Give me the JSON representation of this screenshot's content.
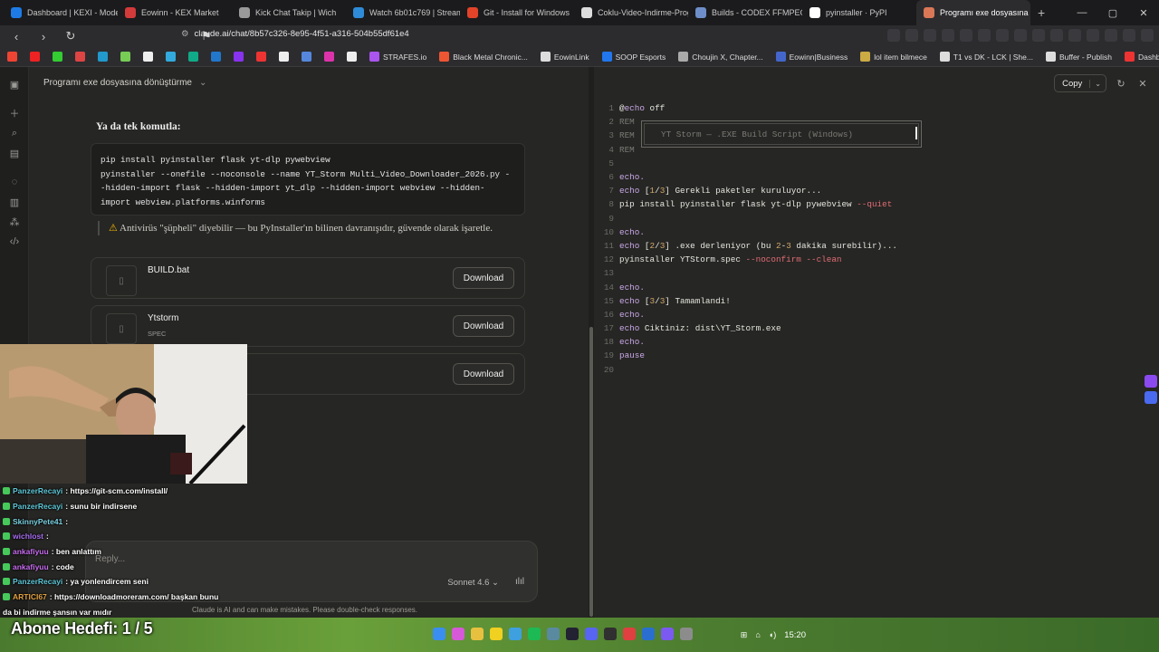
{
  "browser": {
    "tabs": [
      {
        "label": "Dashboard | KEXI - Modern",
        "color": "#1e7be6"
      },
      {
        "label": "Eowinn - KEX Market",
        "color": "#d33a3a"
      },
      {
        "label": "Kick Chat Takip | Wich",
        "color": "#9a9a9a"
      },
      {
        "label": "Watch 6b01c769 | Streamable",
        "color": "#2e8bd8"
      },
      {
        "label": "Git - Install for Windows",
        "color": "#e24329"
      },
      {
        "label": "Coklu-Video-Indirme-Program",
        "color": "#dddddd"
      },
      {
        "label": "Builds - CODEX FFMPEG @",
        "color": "#6e8ec9"
      },
      {
        "label": "pyinstaller · PyPI",
        "color": "#ffffff"
      },
      {
        "label": "Programı exe dosyasına",
        "color": "#d97757"
      }
    ],
    "url": "claude.ai/chat/8b57c326-8e95-4f51-a316-504b55df61e4",
    "bookmarks": [
      {
        "label": "",
        "color": "#e43"
      },
      {
        "label": "",
        "color": "#e22"
      },
      {
        "label": "",
        "color": "#3c3"
      },
      {
        "label": "",
        "color": "#d44"
      },
      {
        "label": "",
        "color": "#29c"
      },
      {
        "label": "",
        "color": "#7c5"
      },
      {
        "label": "",
        "color": "#eee"
      },
      {
        "label": "",
        "color": "#3ad"
      },
      {
        "label": "",
        "color": "#1a8"
      },
      {
        "label": "",
        "color": "#27c"
      },
      {
        "label": "",
        "color": "#83e"
      },
      {
        "label": "",
        "color": "#e33"
      },
      {
        "label": "",
        "color": "#eee"
      },
      {
        "label": "",
        "color": "#58d"
      },
      {
        "label": "",
        "color": "#d3a"
      },
      {
        "label": "",
        "color": "#eee"
      },
      {
        "label": "STRAFES.io",
        "color": "#a5e"
      },
      {
        "label": "Black Metal Chronic...",
        "color": "#e53"
      },
      {
        "label": "EowinLink",
        "color": "#ddd"
      },
      {
        "label": "SOOP Esports",
        "color": "#27e"
      },
      {
        "label": "Choujin X, Chapter...",
        "color": "#aaa"
      },
      {
        "label": "Eowinn|Business",
        "color": "#46c"
      },
      {
        "label": "lol item bilmece",
        "color": "#ca4"
      },
      {
        "label": "T1 vs DK - LCK | She...",
        "color": "#ddd"
      },
      {
        "label": "Buffer - Publish",
        "color": "#ddd"
      },
      {
        "label": "Dashboard | KEXI -...",
        "color": "#e33"
      }
    ]
  },
  "chat": {
    "title": "Programı exe dosyasına dönüştürme",
    "heading": "Ya da tek komutla:",
    "code": "pip install pyinstaller flask yt-dlp pywebview\npyinstaller --onefile --noconsole --name YT_Storm Multi_Video_Downloader_2026.py -\n-hidden-import flask --hidden-import yt_dlp --hidden-import webview --hidden-\nimport webview.platforms.winforms",
    "warning": "Antivirüs \"şüpheli\" diyebilir — bu PyInstaller'ın bilinen davranışıdır, güvende olarak işaretle.",
    "files": [
      {
        "name": "BUILD.bat",
        "sub": "",
        "button": "Download"
      },
      {
        "name": "Ytstorm",
        "sub": "SPEC",
        "button": "Download"
      },
      {
        "name": "",
        "sub": "",
        "button": "Download"
      }
    ],
    "input_placeholder": "Reply...",
    "model": "Sonnet 4.6",
    "disclaimer": "Claude is AI and can make mistakes. Please double-check responses."
  },
  "artifact": {
    "copy_label": "Copy",
    "banner_text": "YT Storm — .EXE Build Script (Windows)",
    "lines": [
      {
        "n": "1",
        "parts": [
          {
            "t": "@",
            "c": "tx"
          },
          {
            "t": "echo",
            "c": "kw"
          },
          {
            "t": " off",
            "c": "tx"
          }
        ]
      },
      {
        "n": "2",
        "parts": [
          {
            "t": "REM",
            "c": "cm"
          }
        ]
      },
      {
        "n": "3",
        "parts": [
          {
            "t": "REM",
            "c": "cm"
          }
        ]
      },
      {
        "n": "4",
        "parts": [
          {
            "t": "REM",
            "c": "cm"
          }
        ]
      },
      {
        "n": "5",
        "parts": []
      },
      {
        "n": "6",
        "parts": [
          {
            "t": "echo.",
            "c": "kw"
          }
        ]
      },
      {
        "n": "7",
        "parts": [
          {
            "t": "echo",
            "c": "kw"
          },
          {
            "t": " [",
            "c": "tx"
          },
          {
            "t": "1",
            "c": "nb"
          },
          {
            "t": "/",
            "c": "tx"
          },
          {
            "t": "3",
            "c": "nb"
          },
          {
            "t": "] Gerekli paketler kuruluyor...",
            "c": "tx"
          }
        ]
      },
      {
        "n": "8",
        "parts": [
          {
            "t": "pip install pyinstaller flask yt-dlp pywebview ",
            "c": "tx"
          },
          {
            "t": "--quiet",
            "c": "fl"
          }
        ]
      },
      {
        "n": "9",
        "parts": []
      },
      {
        "n": "10",
        "parts": [
          {
            "t": "echo.",
            "c": "kw"
          }
        ]
      },
      {
        "n": "11",
        "parts": [
          {
            "t": "echo",
            "c": "kw"
          },
          {
            "t": " [",
            "c": "tx"
          },
          {
            "t": "2",
            "c": "nb"
          },
          {
            "t": "/",
            "c": "tx"
          },
          {
            "t": "3",
            "c": "nb"
          },
          {
            "t": "] .exe derleniyor (bu ",
            "c": "tx"
          },
          {
            "t": "2",
            "c": "nb"
          },
          {
            "t": "-",
            "c": "tx"
          },
          {
            "t": "3",
            "c": "nb"
          },
          {
            "t": " dakika surebilir)...",
            "c": "tx"
          }
        ]
      },
      {
        "n": "12",
        "parts": [
          {
            "t": "pyinstaller YTStorm.spec ",
            "c": "tx"
          },
          {
            "t": "--noconfirm --clean",
            "c": "fl"
          }
        ]
      },
      {
        "n": "13",
        "parts": []
      },
      {
        "n": "14",
        "parts": [
          {
            "t": "echo.",
            "c": "kw"
          }
        ]
      },
      {
        "n": "15",
        "parts": [
          {
            "t": "echo",
            "c": "kw"
          },
          {
            "t": " [",
            "c": "tx"
          },
          {
            "t": "3",
            "c": "nb"
          },
          {
            "t": "/",
            "c": "tx"
          },
          {
            "t": "3",
            "c": "nb"
          },
          {
            "t": "] Tamamlandi!",
            "c": "tx"
          }
        ]
      },
      {
        "n": "16",
        "parts": [
          {
            "t": "echo.",
            "c": "kw"
          }
        ]
      },
      {
        "n": "17",
        "parts": [
          {
            "t": "echo",
            "c": "kw"
          },
          {
            "t": " Ciktiniz: dist\\YT_Storm.exe",
            "c": "tx"
          }
        ]
      },
      {
        "n": "18",
        "parts": [
          {
            "t": "echo.",
            "c": "kw"
          }
        ]
      },
      {
        "n": "19",
        "parts": [
          {
            "t": "pause",
            "c": "kw"
          }
        ]
      },
      {
        "n": "20",
        "parts": []
      }
    ]
  },
  "stream_chat": [
    {
      "user": "PanzerRecayi",
      "color": "#5ec8d8",
      "text": ": https://git-scm.com/install/"
    },
    {
      "user": "PanzerRecayi",
      "color": "#5ec8d8",
      "text": ": sunu bir indirsene"
    },
    {
      "user": "SkinnyPete41",
      "color": "#7ad0e0",
      "text": ":"
    },
    {
      "user": "wichlost",
      "color": "#a86ef0",
      "text": ":"
    },
    {
      "user": "ankafiyuu",
      "color": "#c86cf0",
      "text": ": ben anlattım"
    },
    {
      "user": "ankafiyuu",
      "color": "#c86cf0",
      "text": ": code"
    },
    {
      "user": "PanzerRecayi",
      "color": "#5ec8d8",
      "text": ": ya yonlendircem seni"
    },
    {
      "user": "ARTICI67",
      "color": "#e0a040",
      "text": ": https://downloadmoreram.com/ başkan bunu"
    },
    {
      "user": "",
      "color": "#ffffff",
      "text": "da bi indirme şansın var mıdır"
    }
  ],
  "overlay": {
    "abone": "Abone Hedefi:   1 / 5"
  },
  "taskbar": {
    "clock": "15:20"
  }
}
